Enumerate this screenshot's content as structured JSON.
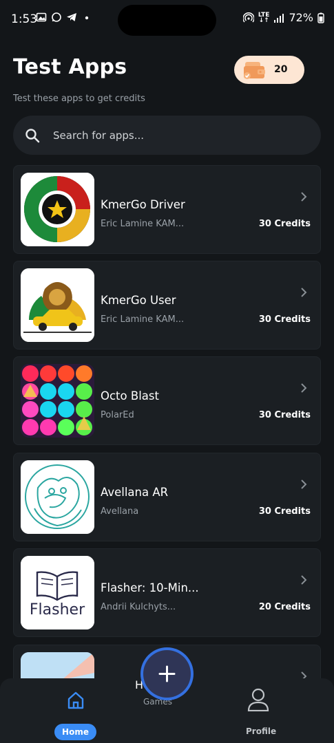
{
  "status_bar": {
    "time": "1:53",
    "battery": "72%",
    "network": "LTE"
  },
  "header": {
    "title": "Test Apps",
    "subtitle": "Test these apps to get credits",
    "credits": "20"
  },
  "search": {
    "placeholder": "Search for apps..."
  },
  "apps": [
    {
      "name": "KmerGo Driver",
      "developer": "Eric Lamine KAM...",
      "credits": "30 Credits"
    },
    {
      "name": "KmerGo User",
      "developer": "Eric Lamine KAM...",
      "credits": "30 Credits"
    },
    {
      "name": "Octo Blast",
      "developer": "PolarEd",
      "credits": "30 Credits"
    },
    {
      "name": "Avellana AR",
      "developer": "Avellana",
      "credits": "30 Credits"
    },
    {
      "name": "Flasher: 10-Min...",
      "developer": "Andrii Kulchyts...",
      "credits": "20 Credits",
      "logo_text": "Flasher"
    }
  ],
  "nav": {
    "home": "Home",
    "games": "Games",
    "profile": "Profile",
    "peek": "Ho"
  },
  "colors": {
    "background": "#131619",
    "card": "#1b1f23",
    "accent": "#3a8cf5",
    "credits_pill": "#fde6d4"
  }
}
